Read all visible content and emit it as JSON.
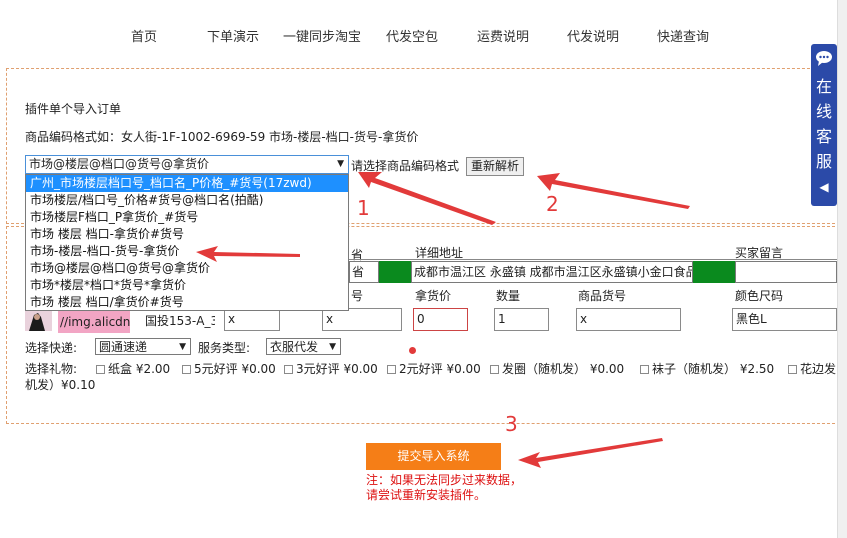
{
  "nav": [
    "首页",
    "下单演示",
    "一键同步淘宝",
    "代发空包",
    "运费说明",
    "代发说明",
    "快递查询"
  ],
  "plugin_title": "插件单个导入订单",
  "code_format_example": "商品编码格式如：女人街-1F-1002-6969-59 市场-楼层-档口-货号-拿货价",
  "format_select": {
    "value": "市场@楼层@档口@货号@拿货价",
    "hint": "请选择商品编码格式",
    "options": [
      "广州_市场楼层档口号_档口名_P价格_#货号(17zwd)",
      "市场楼层/档口号_价格#货号@档口名(拍酷)",
      "市场楼层F档口_P拿货价_#货号",
      "市场 楼层 档口-拿货价#货号",
      "市场-楼层-档口-货号-拿货价",
      "市场@楼层@档口@货号@拿货价",
      "市场*楼层*档口*货号*拿货价",
      "市场 楼层 档口/拿货价#货号"
    ]
  },
  "reparse_label": "重新解析",
  "table": {
    "headers_row1": {
      "province_tail": "省",
      "address": "详细地址",
      "buyer_note": "买家留言"
    },
    "address_value": "成都市温江区 永盛镇  成都市温江区永盛镇小金口食品",
    "headers_row2": {
      "code": "号",
      "price": "拿货价",
      "quantity": "数量",
      "item_no": "商品货号",
      "color_size": "颜色尺码"
    },
    "row": {
      "link": "//img.alicdn.c",
      "goods_code": "国投153-A_3",
      "input_a": "x",
      "input_b": "x",
      "price": "0",
      "quantity": "1",
      "item_no": "x",
      "color_size": "黑色L"
    }
  },
  "express": {
    "label": "选择快递:",
    "value": "圆通速递",
    "service_label": "服务类型:",
    "service_value": "衣服代发"
  },
  "gifts": {
    "label": "选择礼物:",
    "items": [
      "纸盒 ¥2.00",
      "5元好评 ¥0.00",
      "3元好评 ¥0.00",
      "2元好评 ¥0.00",
      "发圈（随机发） ¥0.00",
      "袜子（随机发） ¥2.50",
      "花边发"
    ],
    "wrap": "机发）¥0.10"
  },
  "submit_label": "提交导入系统",
  "note_lines": [
    "注：如果无法同步过来数据，",
    "请尝试重新安装插件。"
  ],
  "annotations": [
    "1",
    "2",
    "3"
  ],
  "side_widget": [
    "在",
    "线",
    "客",
    "服",
    "◀"
  ],
  "colors": {
    "accent_orange": "#f57e17",
    "highlight_blue": "#1e90ff",
    "green_cell": "#0a8a1e",
    "annotation_red": "#e23a3a",
    "widget_blue": "#2b4aa8"
  },
  "icons": [
    "chat-icon",
    "dropdown-arrow-icon",
    "checkbox-icon"
  ]
}
